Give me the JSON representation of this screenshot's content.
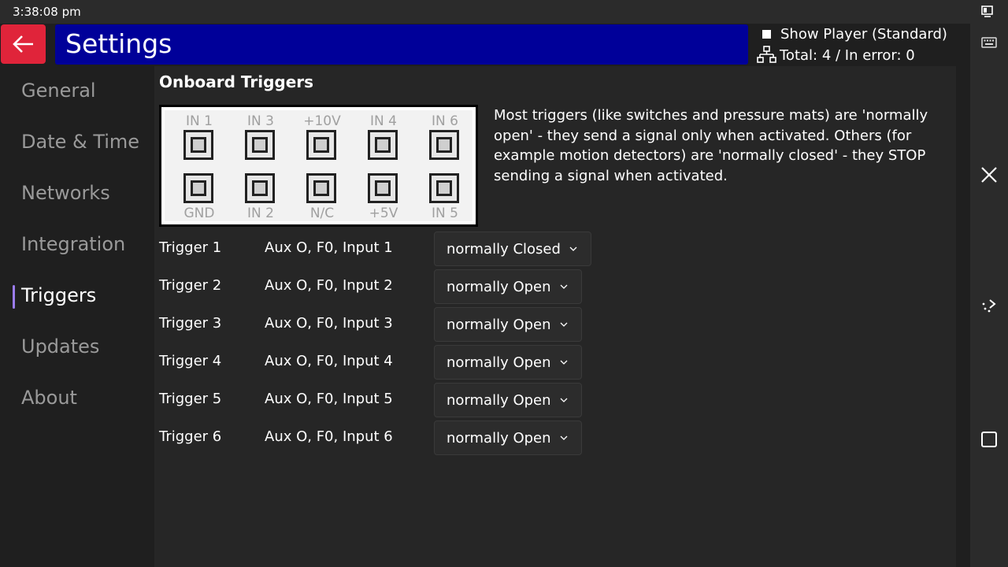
{
  "status_bar": {
    "time": "3:38:08 pm"
  },
  "header": {
    "title": "Settings",
    "show_player_label": "Show Player (Standard)",
    "device_status": "Total: 4 / In error: 0"
  },
  "sidebar": {
    "items": [
      {
        "label": "General"
      },
      {
        "label": "Date & Time"
      },
      {
        "label": "Networks"
      },
      {
        "label": "Integration"
      },
      {
        "label": "Triggers",
        "active": true
      },
      {
        "label": "Updates"
      },
      {
        "label": "About"
      }
    ]
  },
  "main": {
    "section_title": "Onboard Triggers",
    "diagram": {
      "top_labels": [
        "IN 1",
        "IN 3",
        "+10V",
        "IN 4",
        "IN 6"
      ],
      "bottom_labels": [
        "GND",
        "IN 2",
        "N/C",
        "+5V",
        "IN 5"
      ]
    },
    "description": "Most triggers (like switches and pressure mats) are 'normally open' - they send a signal only when activated. Others (for example motion detectors) are 'normally closed' - they STOP sending a signal when activated.",
    "triggers": [
      {
        "name": "Trigger 1",
        "input": "Aux O, F0, Input 1",
        "mode": "normally Closed"
      },
      {
        "name": "Trigger 2",
        "input": "Aux O, F0, Input 2",
        "mode": "normally Open"
      },
      {
        "name": "Trigger 3",
        "input": "Aux O, F0, Input 3",
        "mode": "normally Open"
      },
      {
        "name": "Trigger 4",
        "input": "Aux O, F0, Input 4",
        "mode": "normally Open"
      },
      {
        "name": "Trigger 5",
        "input": "Aux O, F0, Input 5",
        "mode": "normally Open"
      },
      {
        "name": "Trigger 6",
        "input": "Aux O, F0, Input 6",
        "mode": "normally Open"
      }
    ]
  },
  "colors": {
    "back_button": "#e0243a",
    "title_bar": "#000099",
    "active_indicator": "#9b7cf0"
  },
  "icons": {
    "back": "arrow-left-icon",
    "network": "network-icon",
    "keyboard": "keyboard-icon",
    "close": "close-icon",
    "rotate": "rotate-icon",
    "window": "square-icon",
    "chevron": "chevron-down-icon"
  }
}
